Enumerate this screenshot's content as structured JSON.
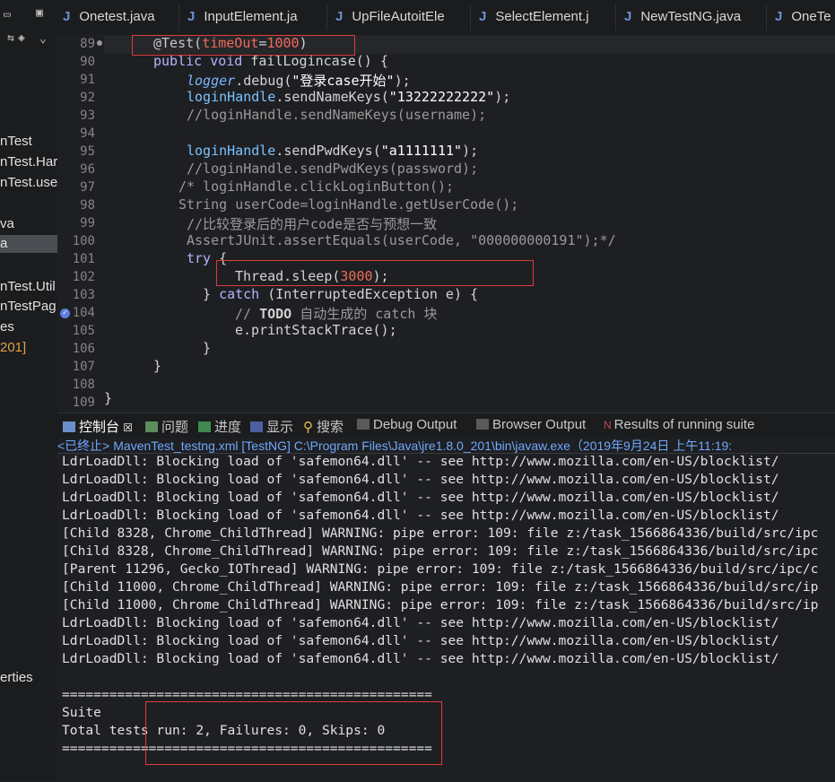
{
  "left_panel": {
    "items": [
      {
        "label": "nTest",
        "selected": false,
        "numeric": false
      },
      {
        "label": "nTest.Har",
        "selected": false,
        "numeric": false
      },
      {
        "label": "nTest.use",
        "selected": false,
        "numeric": false
      },
      {
        "label": "va",
        "selected": false,
        "numeric": false
      },
      {
        "label": "a",
        "selected": true,
        "numeric": false
      },
      {
        "label": "nTest.Util",
        "selected": false,
        "numeric": false
      },
      {
        "label": "nTestPag",
        "selected": false,
        "numeric": false
      },
      {
        "label": "es",
        "selected": false,
        "numeric": false
      },
      {
        "label": "201]",
        "selected": false,
        "numeric": true
      },
      {
        "label": "erties",
        "selected": false,
        "numeric": false
      }
    ]
  },
  "tabs": [
    "Onetest.java",
    "InputElement.ja",
    "UpFileAutoitEle",
    "SelectElement.j",
    "NewTestNG.java",
    "OneTe"
  ],
  "tab_icon": "J",
  "editor": {
    "line_numbers": [
      "89",
      "90",
      "91",
      "92",
      "93",
      "94",
      "95",
      "96",
      "97",
      "98",
      "99",
      "100",
      "101",
      "102",
      "103",
      "104",
      "105",
      "106",
      "107",
      "108",
      "109"
    ],
    "code": {
      "l89_ann": "@Test(",
      "l89_key": "timeOut",
      "l89_eq": "=",
      "l89_val": "1000",
      "l89_close": ")",
      "l90_kw": "public void",
      "l90_rest": " failLogincase() {",
      "l91_it": "logger",
      "l91_mid": ".debug(",
      "l91_str": "\"登录case开始\"",
      "l91_end": ");",
      "l92_field": "loginHandle",
      "l92_mid": ".sendNameKeys(",
      "l92_str": "\"13222222222\"",
      "l92_end": ");",
      "l93": "//loginHandle.sendNameKeys(username);",
      "l95_field": "loginHandle",
      "l95_mid": ".sendPwdKeys(",
      "l95_str": "\"a1111111\"",
      "l95_end": ");",
      "l96": "//loginHandle.sendPwdKeys(password);",
      "l97": "/* loginHandle.clickLoginButton();",
      "l98": "String userCode=loginHandle.getUserCode();",
      "l99": "//比较登录后的用户code是否与预想一致",
      "l100": "AssertJUnit.assertEquals(userCode, \"000000000191\");*/",
      "l101_kw": "try",
      "l101_rest": " {",
      "l102_a": "Thread.sleep(",
      "l102_num": "3000",
      "l102_b": ");",
      "l103_a": "} ",
      "l103_kw": "catch",
      "l103_b": " (InterruptedException e) {",
      "l104_a": "// ",
      "l104_todo": "TODO",
      "l104_b": " 自动生成的 catch 块",
      "l105": "e.printStackTrace();",
      "l106": "}",
      "l107": "}",
      "l109": "}"
    }
  },
  "console_tabs": [
    "控制台",
    "问题",
    "进度",
    "显示",
    "搜索",
    "Debug Output",
    "Browser Output",
    "Results of running suite"
  ],
  "console_tab_close": "☒",
  "status_line": "<已终止> MavenTest_testng.xml [TestNG] C:\\Program Files\\Java\\jre1.8.0_201\\bin\\javaw.exe（2019年9月24日 上午11:19:",
  "console_lines": [
    "LdrLoadDll: Blocking load of 'safemon64.dll' -- see http://www.mozilla.com/en-US/blocklist/",
    "LdrLoadDll: Blocking load of 'safemon64.dll' -- see http://www.mozilla.com/en-US/blocklist/",
    "LdrLoadDll: Blocking load of 'safemon64.dll' -- see http://www.mozilla.com/en-US/blocklist/",
    "LdrLoadDll: Blocking load of 'safemon64.dll' -- see http://www.mozilla.com/en-US/blocklist/",
    "[Child 8328, Chrome_ChildThread] WARNING: pipe error: 109: file z:/task_1566864336/build/src/ipc",
    "[Child 8328, Chrome_ChildThread] WARNING: pipe error: 109: file z:/task_1566864336/build/src/ipc",
    "[Parent 11296, Gecko_IOThread] WARNING: pipe error: 109: file z:/task_1566864336/build/src/ipc/c",
    "[Child 11000, Chrome_ChildThread] WARNING: pipe error: 109: file z:/task_1566864336/build/src/ip",
    "[Child 11000, Chrome_ChildThread] WARNING: pipe error: 109: file z:/task_1566864336/build/src/ip",
    "LdrLoadDll: Blocking load of 'safemon64.dll' -- see http://www.mozilla.com/en-US/blocklist/",
    "LdrLoadDll: Blocking load of 'safemon64.dll' -- see http://www.mozilla.com/en-US/blocklist/",
    "LdrLoadDll: Blocking load of 'safemon64.dll' -- see http://www.mozilla.com/en-US/blocklist/",
    "",
    "===============================================",
    "Suite",
    "Total tests run: 2, Failures: 0, Skips: 0",
    "==============================================="
  ],
  "colors": {
    "highlight_box": "#e03b3b",
    "keyword": "#b4b4ff",
    "number_literal": "#f26a5a",
    "status_link": "#6fa8ff"
  }
}
